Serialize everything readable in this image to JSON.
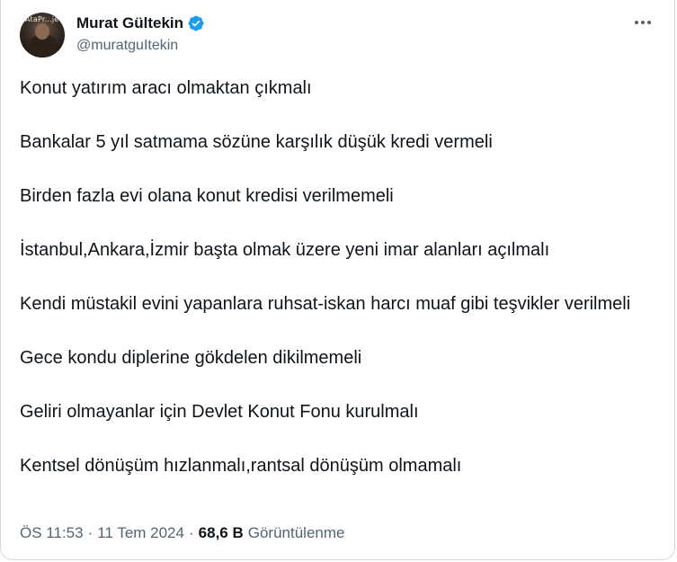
{
  "author": {
    "name": "Murat Gültekin",
    "handle": "@muratguItekin",
    "avatar_label": "AtaPr...je",
    "verified_color": "#1d9bf0"
  },
  "tweet": {
    "lines": [
      "Konut yatırım aracı olmaktan çıkmalı",
      "Bankalar 5 yıl satmama sözüne karşılık düşük kredi vermeli",
      "Birden fazla evi olana konut kredisi verilmemeli",
      "İstanbul,Ankara,İzmir başta olmak üzere yeni imar alanları açılmalı",
      "Kendi müstakil evini yapanlara ruhsat-iskan harcı muaf gibi teşvikler verilmeli",
      "Gece kondu diplerine gökdelen dikilmemeli",
      "Geliri olmayanlar için Devlet Konut Fonu kurulmalı",
      "Kentsel dönüşüm hızlanmalı,rantsal dönüşüm olmamalı"
    ]
  },
  "meta": {
    "time": "ÖS 11:53",
    "separator": "·",
    "date": "11 Tem 2024",
    "views_count": "68,6 B",
    "views_label": "Görüntülenme"
  },
  "icons": {
    "more": "more-icon",
    "verified": "verified-badge-icon"
  }
}
